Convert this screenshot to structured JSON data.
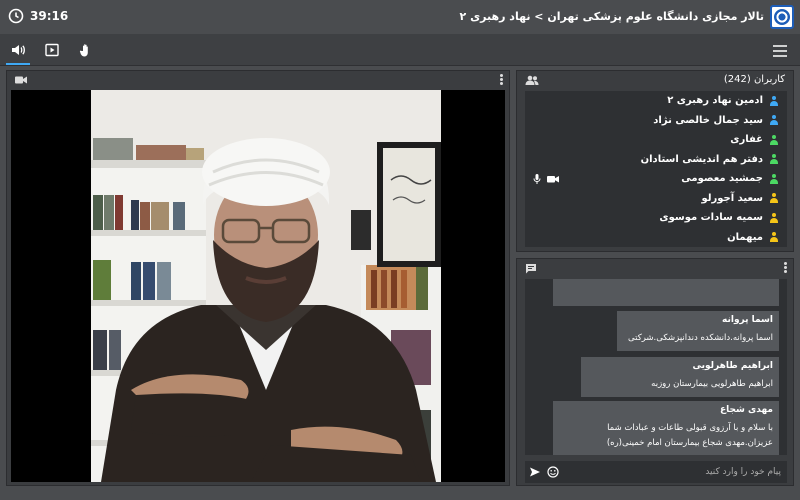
{
  "timer": "39:16",
  "room_title": "تالار مجازی دانشگاه علوم پزشکی تهران > نهاد رهبری ۲",
  "users": {
    "title": "کاربران (242)",
    "list": [
      {
        "name": "ادمین نهاد رهبری ۲",
        "role_color": "#3fa9f5"
      },
      {
        "name": "سید جمال خالصی نژاد",
        "role_color": "#3fa9f5"
      },
      {
        "name": "غفاری",
        "role_color": "#4cd964"
      },
      {
        "name": "دفتر هم اندیشی استادان",
        "role_color": "#4cd964"
      },
      {
        "name": "جمشید معصومی",
        "role_color": "#4cd964"
      },
      {
        "name": "سعید آجورلو",
        "role_color": "#f5c518"
      },
      {
        "name": "سمیه سادات موسوی",
        "role_color": "#f5c518"
      },
      {
        "name": "میهمان",
        "role_color": "#f5c518"
      }
    ]
  },
  "chat": {
    "messages": [
      {
        "author": "اسما پروانه",
        "text": "اسما پروانه.دانشکده دندانپزشکی.شرکتی"
      },
      {
        "author": "ابراهیم طاهرلویی",
        "text": "ابراهیم طاهرلویی بیمارستان روزبه"
      },
      {
        "author": "مهدی شجاع",
        "text": "با سلام و با آرزوی قبولی طاعات و عبادات شما عزیزان.مهدی شجاع بیمارستان امام خمینی(ره)"
      }
    ],
    "input_placeholder": "پیام خود را وارد کنید"
  }
}
